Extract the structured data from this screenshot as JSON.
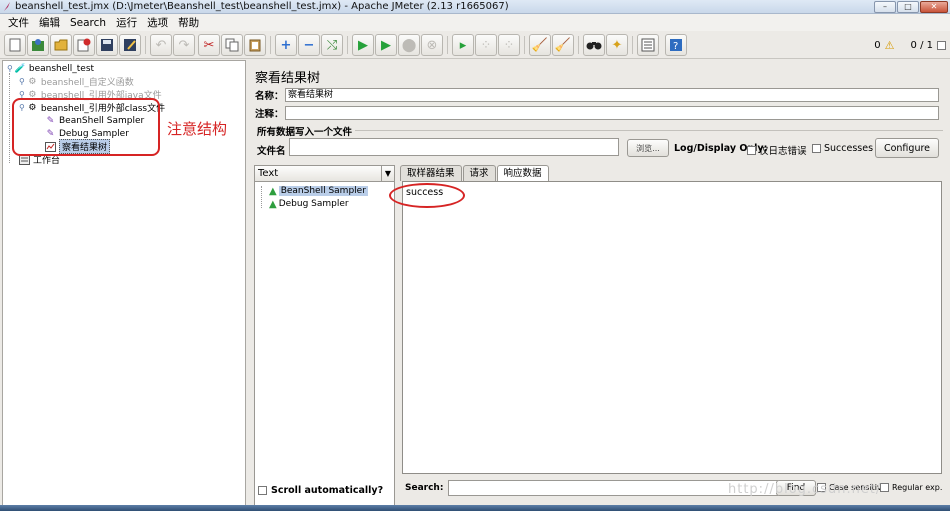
{
  "window": {
    "title": "beanshell_test.jmx (D:\\Jmeter\\Beanshell_test\\beanshell_test.jmx) - Apache JMeter (2.13 r1665067)",
    "controls": {
      "minimize": "–",
      "maximize": "□",
      "close": "✕"
    }
  },
  "menu": [
    "文件",
    "编辑",
    "Search",
    "运行",
    "选项",
    "帮助"
  ],
  "toolbar": {
    "warning_count": "0",
    "thread_counter": "0 / 1"
  },
  "tree": {
    "test_plan": "beanshell_test",
    "items": [
      {
        "label": "beanshell_自定义函数",
        "disabled": true
      },
      {
        "label": "beanshell_引用外部java文件",
        "disabled": true
      },
      {
        "label": "beanshell_引用外部class文件",
        "disabled": false
      },
      {
        "label": "BeanShell Sampler",
        "disabled": false
      },
      {
        "label": "Debug Sampler",
        "disabled": false
      },
      {
        "label": "察看结果树",
        "disabled": false,
        "selected": true
      },
      {
        "label": "工作台",
        "disabled": false
      }
    ],
    "annotation": "注意结构"
  },
  "panel": {
    "title": "察看结果树",
    "name_label": "名称：",
    "name_value": "察看结果树",
    "comment_label": "注释：",
    "comment_value": "",
    "group_title": "所有数据写入一个文件",
    "file_label": "文件名",
    "file_value": "",
    "browse_button": "浏览...",
    "log_display_only": "Log/Display Only:",
    "errors_only": "仅日志错误",
    "successes": "Successes",
    "configure_button": "Configure"
  },
  "renderer": {
    "selected": "Text",
    "samples": [
      {
        "label": "BeanShell Sampler",
        "selected": true
      },
      {
        "label": "Debug Sampler",
        "selected": false
      }
    ],
    "scroll_auto": "Scroll automatically?"
  },
  "tabs": [
    "取样器结果",
    "请求",
    "响应数据"
  ],
  "active_tab": "响应数据",
  "result": {
    "text": "success"
  },
  "search": {
    "label": "Search:",
    "value": "",
    "find_button": "Find",
    "case_sensitive": "Case sensitive",
    "regular_exp": "Regular exp."
  },
  "watermark": "http://blog.csdn.net/",
  "colors": {
    "selection": "#b9cde8",
    "annotation_red": "#d62424",
    "success_green": "#2e9e3e"
  }
}
